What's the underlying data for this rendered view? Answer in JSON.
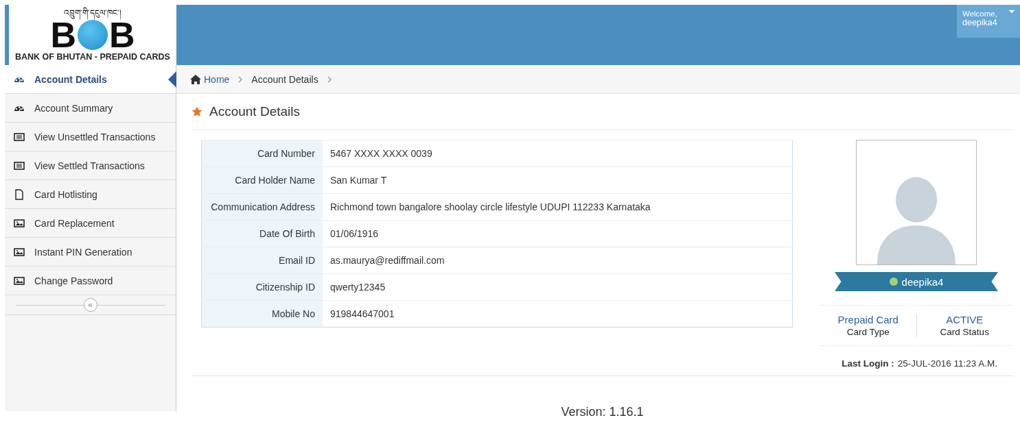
{
  "logo": {
    "tagline": "འབྲུག་གི་དངུལ་ཁང་།",
    "letters": [
      "B",
      "B"
    ],
    "subtitle": "BANK OF BHUTAN - PREPAID CARDS"
  },
  "user_menu": {
    "greeting": "Welcome,",
    "username": "deepika4"
  },
  "sidebar": {
    "items": [
      {
        "label": "Account Details",
        "kind": "gauge",
        "selected": true
      },
      {
        "label": "Account Summary",
        "kind": "gauge",
        "selected": false
      },
      {
        "label": "View Unsettled Transactions",
        "kind": "list",
        "selected": false
      },
      {
        "label": "View Settled Transactions",
        "kind": "list",
        "selected": false
      },
      {
        "label": "Card Hotlisting",
        "kind": "page",
        "selected": false
      },
      {
        "label": "Card Replacement",
        "kind": "image",
        "selected": false
      },
      {
        "label": "Instant PIN Generation",
        "kind": "image",
        "selected": false
      },
      {
        "label": "Change Password",
        "kind": "image",
        "selected": false
      }
    ],
    "collapse": "«"
  },
  "breadcrumb": [
    "Home",
    "Account Details"
  ],
  "page_title": "Account Details",
  "details": [
    {
      "label": "Card Number",
      "value": "5467 XXXX XXXX 0039"
    },
    {
      "label": "Card Holder Name",
      "value": "San Kumar T"
    },
    {
      "label": "Communication Address",
      "value": "Richmond town bangalore shoolay circle lifestyle UDUPI 112233 Karnataka"
    },
    {
      "label": "Date Of Birth",
      "value": "01/06/1916"
    },
    {
      "label": "Email ID",
      "value": "as.maurya@rediffmail.com"
    },
    {
      "label": "Citizenship ID",
      "value": "qwerty12345"
    },
    {
      "label": "Mobile No",
      "value": "919844647001"
    }
  ],
  "profile": {
    "username": "deepika4",
    "online": true,
    "stats": [
      {
        "value": "Prepaid Card",
        "label": "Card Type"
      },
      {
        "value": "ACTIVE",
        "label": "Card Status"
      }
    ],
    "last_login_label": "Last Login :",
    "last_login": "25-JUL-2016 11:23 A.M."
  },
  "version": "Version: 1.16.1"
}
